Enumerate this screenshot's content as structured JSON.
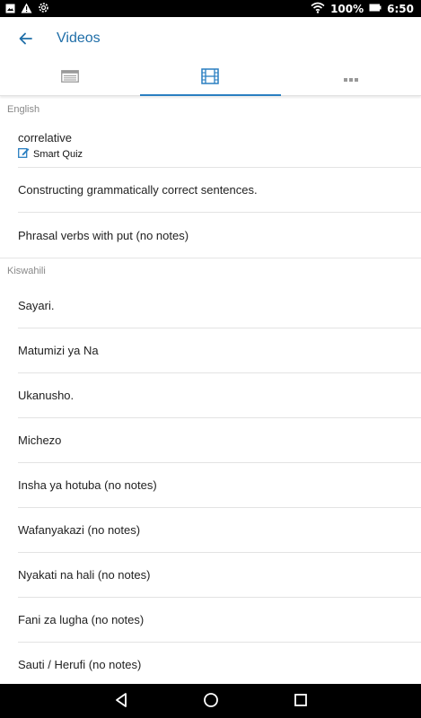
{
  "status_bar": {
    "battery": "100%",
    "time": "6:50",
    "icons": [
      "image-icon",
      "warning-icon",
      "settings-icon",
      "wifi-icon",
      "battery-icon"
    ]
  },
  "app_bar": {
    "title": "Videos",
    "back_icon": "arrow-left-icon"
  },
  "tabs": [
    {
      "icon": "list-icon",
      "active": false
    },
    {
      "icon": "film-icon",
      "active": true
    },
    {
      "icon": "more-icon",
      "active": false
    }
  ],
  "sections": [
    {
      "header": "English",
      "items": [
        {
          "label": "correlative",
          "badge": "Smart Quiz",
          "badge_icon": "edit-icon"
        },
        {
          "label": "Constructing grammatically correct sentences."
        },
        {
          "label": "Phrasal verbs with put (no notes)"
        }
      ]
    },
    {
      "header": "Kiswahili",
      "items": [
        {
          "label": "Sayari."
        },
        {
          "label": "Matumizi ya Na"
        },
        {
          "label": "Ukanusho."
        },
        {
          "label": "Michezo"
        },
        {
          "label": "Insha ya hotuba (no notes)"
        },
        {
          "label": "Wafanyakazi (no notes)"
        },
        {
          "label": "Nyakati na hali (no notes)"
        },
        {
          "label": "Fani za lugha (no notes)"
        },
        {
          "label": "Sauti / Herufi (no notes)"
        }
      ]
    }
  ],
  "nav_bar": {
    "icons": [
      "back-triangle-icon",
      "home-circle-icon",
      "recents-square-icon"
    ]
  },
  "colors": {
    "accent": "#2a7fc1",
    "title": "#1f6ea8",
    "status_bar": "#000000",
    "nav_bar": "#000000"
  }
}
